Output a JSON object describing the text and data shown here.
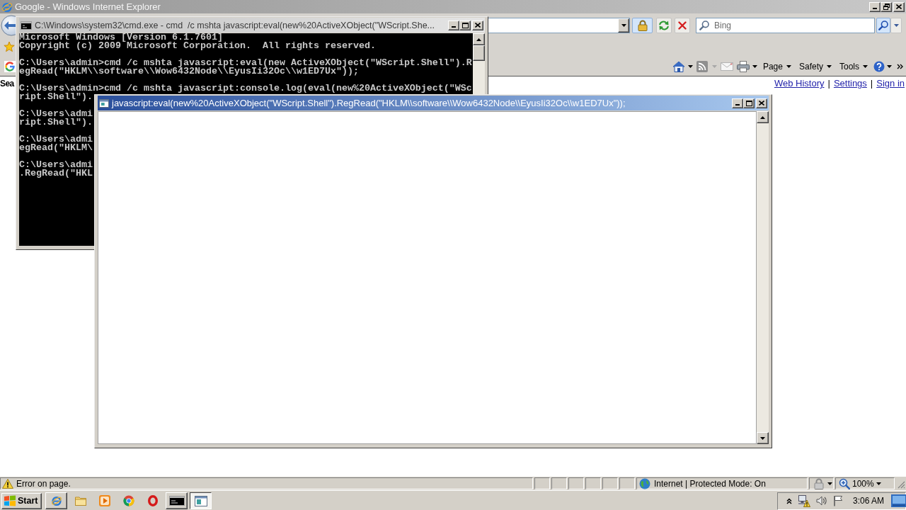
{
  "ie_window": {
    "title": "Google - Windows Internet Explorer",
    "active": false,
    "search_field": {
      "placeholder": "Bing"
    },
    "command_menus": [
      {
        "label": "Page"
      },
      {
        "label": "Safety"
      },
      {
        "label": "Tools"
      }
    ],
    "page": {
      "text_fragment": "Sea",
      "links": [
        {
          "label": "Web History"
        },
        {
          "label": "Settings"
        },
        {
          "label": "Sign in"
        }
      ],
      "separators": [
        "|",
        "|"
      ]
    },
    "status_bar": {
      "message": "Error on page.",
      "zone": "Internet | Protected Mode: On",
      "zoom": "100%"
    }
  },
  "cmd_window": {
    "title": "C:\\Windows\\system32\\cmd.exe - cmd  /c mshta javascript:eval(new%20ActiveXObject(\"WScript.She...",
    "active": false,
    "blocks": [
      [
        "Microsoft Windows [Version 6.1.7601]",
        "Copyright (c) 2009 Microsoft Corporation.  All rights reserved."
      ],
      [
        "C:\\Users\\admin>cmd /c mshta javascript:eval(new ActiveXObject(\"WScript.Shell\").R",
        "egRead(\"HKLM\\\\software\\\\Wow6432Node\\\\EyusIi32Oc\\\\w1ED7Ux\"));"
      ],
      [
        "C:\\Users\\admin>cmd /c mshta javascript:console.log(eval(new%20ActiveXObject(\"WSc",
        "ript.Shell\")."
      ],
      [
        "C:\\Users\\admi",
        "ript.Shell\")."
      ],
      [
        "C:\\Users\\admi",
        "egRead(\"HKLM\\"
      ],
      [
        "C:\\Users\\admi",
        ".RegRead(\"HKL"
      ]
    ]
  },
  "script_window": {
    "title": "javascript:eval(new%20ActiveXObject(\"WScript.Shell\").RegRead(\"HKLM\\\\software\\\\Wow6432Node\\\\EyusIi32Oc\\\\w1ED7Ux\"));",
    "active": true
  },
  "taskbar": {
    "start_label": "Start",
    "buttons": [
      {
        "kind": "ie",
        "running": true,
        "selected": false
      },
      {
        "kind": "folder",
        "running": false,
        "selected": false
      },
      {
        "kind": "media",
        "running": false,
        "selected": false
      },
      {
        "kind": "chrome",
        "running": false,
        "selected": false
      },
      {
        "kind": "opera",
        "running": false,
        "selected": false
      },
      {
        "kind": "console",
        "running": true,
        "selected": false
      },
      {
        "kind": "window",
        "running": true,
        "selected": true
      }
    ],
    "clock": "3:06 AM"
  }
}
